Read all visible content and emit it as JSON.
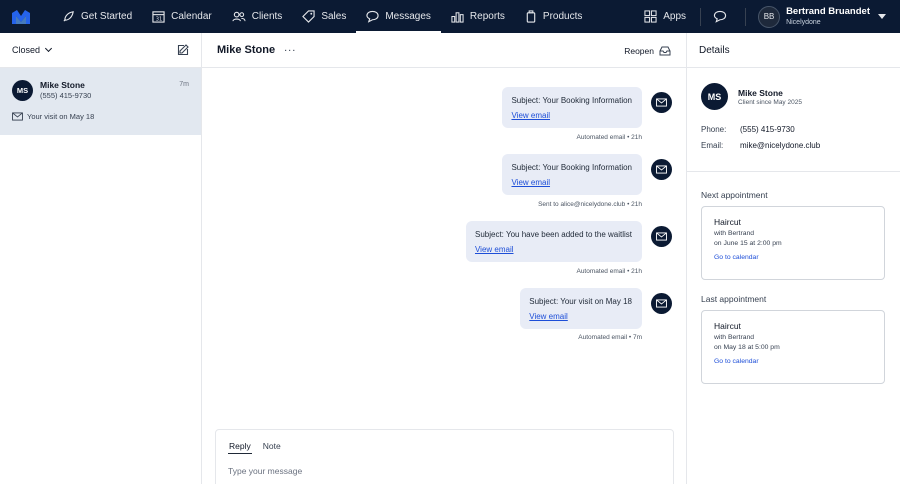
{
  "nav": {
    "items": [
      {
        "label": "Get Started",
        "icon": "rocket-icon"
      },
      {
        "label": "Calendar",
        "icon": "calendar-icon"
      },
      {
        "label": "Clients",
        "icon": "clients-icon"
      },
      {
        "label": "Sales",
        "icon": "tag-icon"
      },
      {
        "label": "Messages",
        "icon": "chat-icon"
      },
      {
        "label": "Reports",
        "icon": "chart-icon"
      },
      {
        "label": "Products",
        "icon": "product-icon"
      }
    ],
    "apps_label": "Apps",
    "user_initials": "BB",
    "user_name": "Bertrand Bruandet",
    "user_business": "Nicelydone"
  },
  "left": {
    "filter_label": "Closed",
    "conversation": {
      "initials": "MS",
      "name": "Mike Stone",
      "phone": "(555) 415-9730",
      "time": "7m",
      "preview": "Your visit on May 18"
    }
  },
  "middle": {
    "title": "Mike Stone",
    "reopen_label": "Reopen",
    "messages": [
      {
        "subject": "Subject: Your Booking Information",
        "link": "View email",
        "meta": "Automated email • 21h"
      },
      {
        "subject": "Subject: Your Booking Information",
        "link": "View email",
        "meta": "Sent to alice@nicelydone.club • 21h"
      },
      {
        "subject": "Subject: You have been added to the waitlist",
        "link": "View email",
        "meta": "Automated email • 21h"
      },
      {
        "subject": "Subject: Your visit on May 18",
        "link": "View email",
        "meta": "Automated email • 7m"
      }
    ],
    "compose": {
      "tab_reply": "Reply",
      "tab_note": "Note",
      "placeholder": "Type your message"
    }
  },
  "right": {
    "title": "Details",
    "contact": {
      "initials": "MS",
      "name": "Mike Stone",
      "since": "Client since May 2025",
      "phone_label": "Phone:",
      "phone": "(555) 415-9730",
      "email_label": "Email:",
      "email": "mike@nicelydone.club"
    },
    "next_label": "Next appointment",
    "next": {
      "service": "Haircut",
      "with": "with Bertrand",
      "when": "on June 15 at 2:00 pm",
      "link": "Go to calendar"
    },
    "last_label": "Last appointment",
    "last": {
      "service": "Haircut",
      "with": "with Bertrand",
      "when": "on May 18 at 5:00 pm",
      "link": "Go to calendar"
    }
  }
}
